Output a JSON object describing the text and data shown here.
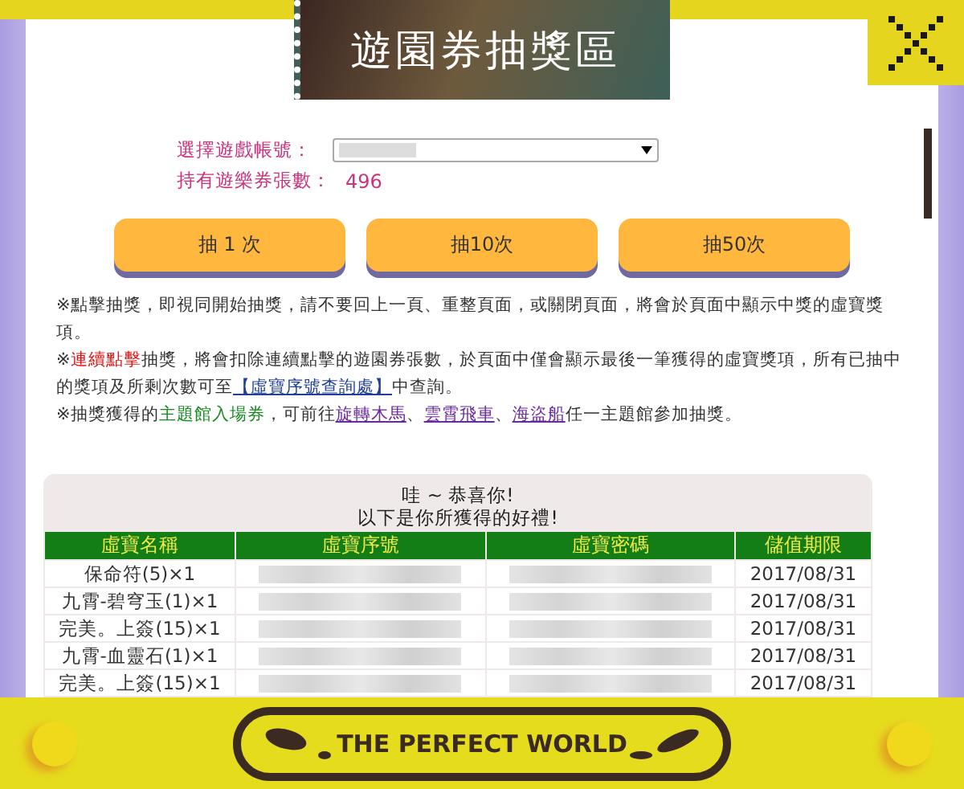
{
  "header": {
    "title": "遊園券抽獎區"
  },
  "account": {
    "label": "選擇遊戲帳號：",
    "count_label": "持有遊樂券張數：",
    "count": "496"
  },
  "draw_buttons": [
    "抽 1 次",
    "抽10次",
    "抽50次"
  ],
  "notes": [
    [
      {
        "kind": "text",
        "text": "※點擊抽獎，即視同開始抽獎，請不要回上一頁、重整頁面，或關閉頁面，將會於頁面中顯示中獎的虛寶獎項。"
      }
    ],
    [
      {
        "kind": "text",
        "text": "※"
      },
      {
        "kind": "red",
        "text": "連續點擊"
      },
      {
        "kind": "text",
        "text": "抽獎，將會扣除連續點擊的遊園券張數，於頁面中僅會顯示最後一筆獲得的虛寶獎項，所有已抽中的獎項及所剩次數可至"
      },
      {
        "kind": "link",
        "text": "【虛寶序號查詢處】"
      },
      {
        "kind": "text",
        "text": "中查詢。"
      }
    ],
    [
      {
        "kind": "text",
        "text": "※抽獎獲得的"
      },
      {
        "kind": "green",
        "text": "主題館入場券"
      },
      {
        "kind": "text",
        "text": "，可前往"
      },
      {
        "kind": "visited",
        "text": "旋轉木馬"
      },
      {
        "kind": "text",
        "text": "、"
      },
      {
        "kind": "visited",
        "text": "雲霄飛車"
      },
      {
        "kind": "text",
        "text": "、"
      },
      {
        "kind": "visited",
        "text": "海盜船"
      },
      {
        "kind": "text",
        "text": "任一主題館參加抽獎。"
      }
    ]
  ],
  "result": {
    "line_1": "哇 ~ 恭喜你!",
    "line_2": "以下是你所獲得的好禮!",
    "columns": [
      "虛寶名稱",
      "虛寶序號",
      "虛寶密碼",
      "儲值期限"
    ],
    "rows": [
      {
        "name": "保命符(5)×1",
        "expiry": "2017/08/31"
      },
      {
        "name": "九霄-碧穹玉(1)×1",
        "expiry": "2017/08/31"
      },
      {
        "name": "完美。上簽(15)×1",
        "expiry": "2017/08/31"
      },
      {
        "name": "九霄-血靈石(1)×1",
        "expiry": "2017/08/31"
      },
      {
        "name": "完美。上簽(15)×1",
        "expiry": "2017/08/31"
      }
    ]
  },
  "footer": {
    "brand": "THE PERFECT WORLD"
  }
}
